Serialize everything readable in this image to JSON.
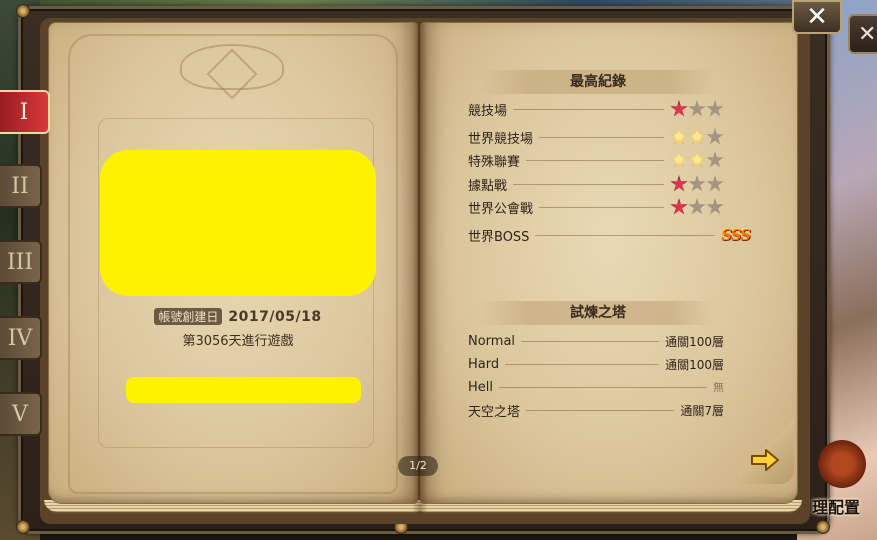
{
  "tabs": [
    {
      "label": "I",
      "active": true
    },
    {
      "label": "II",
      "active": false
    },
    {
      "label": "III",
      "active": false
    },
    {
      "label": "IV",
      "active": false
    },
    {
      "label": "V",
      "active": false
    }
  ],
  "left_page": {
    "created_label": "帳號創建日",
    "created_date": "2017/05/18",
    "days_text": "第3056天進行遊戲"
  },
  "pagination": {
    "text": "1/2"
  },
  "best_records": {
    "title": "最高紀錄",
    "rows": [
      {
        "name": "競技場",
        "stars": [
          "red",
          "empty",
          "empty"
        ]
      },
      {
        "name": "世界競技場",
        "stars": [
          "gold",
          "gold",
          "empty"
        ]
      },
      {
        "name": "特殊聯賽",
        "stars": [
          "gold",
          "gold",
          "empty"
        ]
      },
      {
        "name": "據點戰",
        "stars": [
          "red",
          "empty",
          "empty"
        ]
      },
      {
        "name": "世界公會戰",
        "stars": [
          "red",
          "empty",
          "empty"
        ]
      },
      {
        "name": "世界BOSS",
        "rank": "SSS"
      }
    ]
  },
  "trial_tower": {
    "title": "試煉之塔",
    "rows": [
      {
        "name": "Normal",
        "value": "通關100層"
      },
      {
        "name": "Hard",
        "value": "通關100層"
      },
      {
        "name": "Hell",
        "value": "無"
      },
      {
        "name": "天空之塔",
        "value": "通關7層"
      }
    ]
  },
  "buttons": {
    "close": "✕",
    "close_secondary": "✕",
    "side_label": "理配置"
  },
  "colors": {
    "redaction": "#fff200",
    "star_red": "#d8384a",
    "star_gold": "#f2c43a",
    "star_empty": "#a39582",
    "rank_sss": "#ff7a10"
  },
  "icons": {
    "next": "right-arrow-icon",
    "close": "close-icon"
  }
}
